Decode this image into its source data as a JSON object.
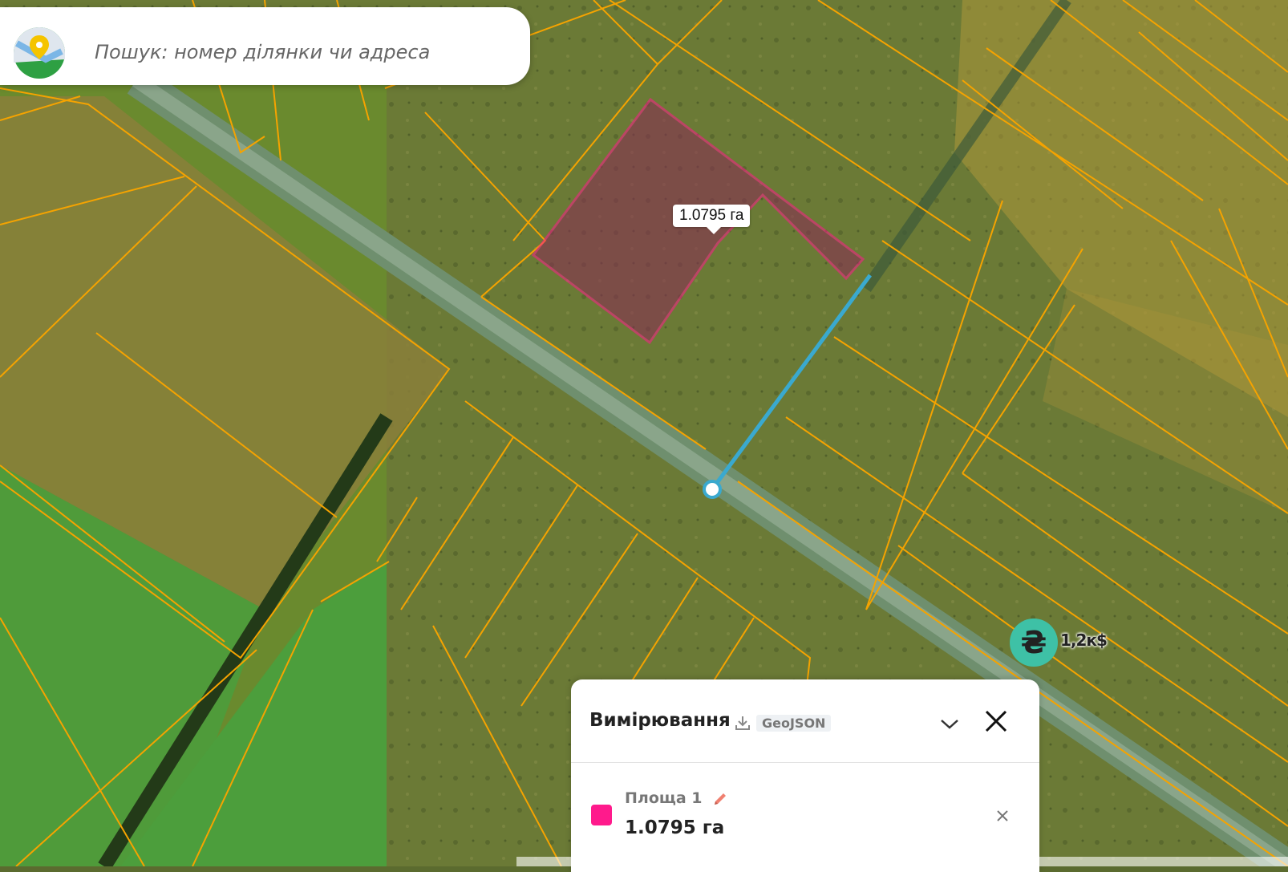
{
  "search": {
    "placeholder": "Пошук: номер ділянки чи адреса"
  },
  "map": {
    "selected_area_label": "1.0795 га",
    "price_marker": {
      "symbol": "₴",
      "label": "1,2к$"
    },
    "colors": {
      "parcel_border": "#f5a300",
      "selection": "#ff1a8c",
      "measure_line": "#3aa9cf"
    }
  },
  "measurement_panel": {
    "title": "Вимірювання",
    "export_label": "GeoJSON",
    "items": [
      {
        "name": "Площа 1",
        "value": "1.0795 га",
        "color": "#ff1a8c"
      }
    ]
  }
}
